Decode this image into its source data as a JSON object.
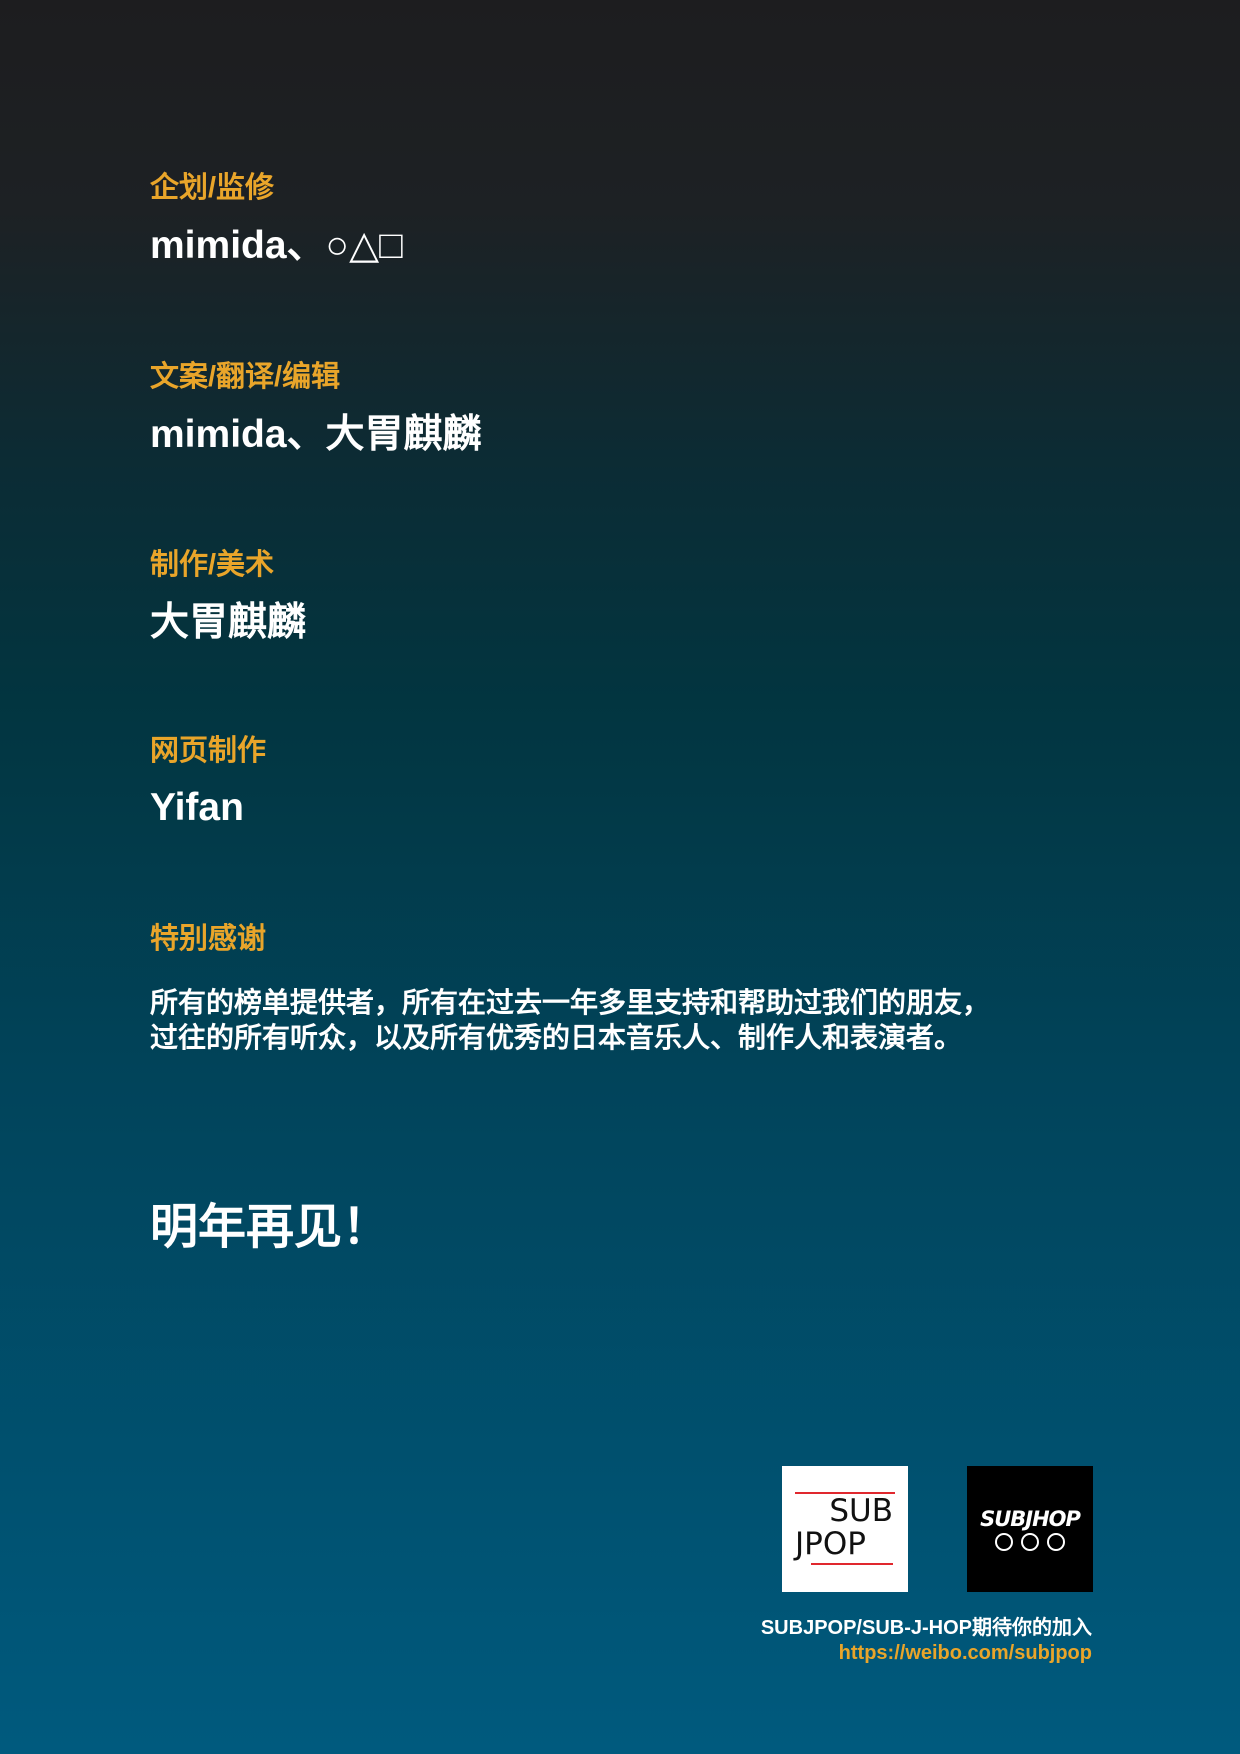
{
  "credits": [
    {
      "role": "企划/监修",
      "names": "mimida、○△□"
    },
    {
      "role": "文案/翻译/编辑",
      "names": "mimida、大胃麒麟"
    },
    {
      "role": "制作/美术",
      "names": "大胃麒麟"
    },
    {
      "role": "网页制作",
      "names": "Yifan"
    }
  ],
  "thanks": {
    "label": "特别感谢",
    "lines": [
      "所有的榜单提供者，所有在过去一年多里支持和帮助过我们的朋友，",
      "过往的所有听众，以及所有优秀的日本音乐人、制作人和表演者。"
    ]
  },
  "farewell": "明年再见！",
  "logos": {
    "subjpop": {
      "line1": "SUB",
      "line2": "JPOP",
      "icon": "subjpop-logo"
    },
    "subjhop": {
      "text": "SUBJHOP",
      "icon": "subjhop-logo"
    }
  },
  "footer": {
    "invite": "SUBJPOP/SUB-J-HOP期待你的加入",
    "link": "https://weibo.com/subjpop"
  },
  "colors": {
    "accent": "#e9a52a",
    "text": "#ffffff",
    "bg_top": "#1d1d1f",
    "bg_mid": "#023540",
    "bg_bottom": "#005a7e",
    "logo_red": "#e0282e"
  }
}
